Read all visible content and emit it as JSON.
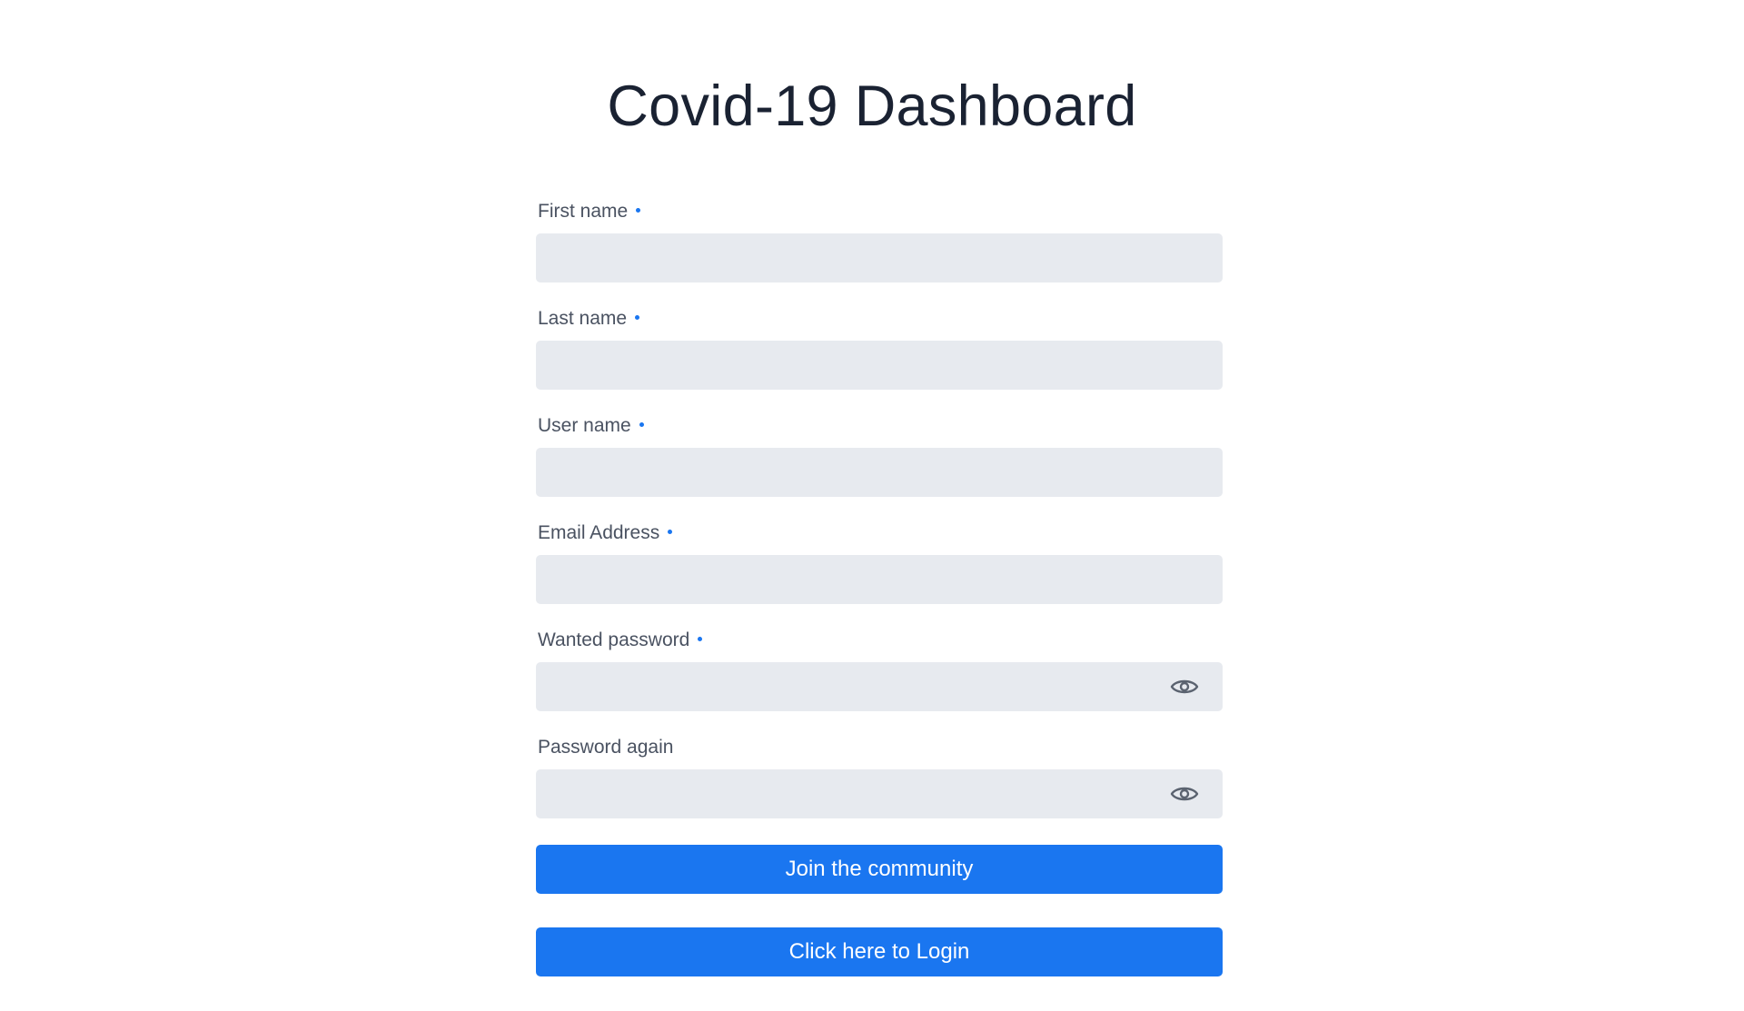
{
  "page": {
    "title": "Covid-19 Dashboard"
  },
  "colors": {
    "accent": "#1a76f0",
    "input_bg": "#e7eaef",
    "label_text": "#4a5261",
    "title_text": "#1a2232",
    "icon": "#5b6370"
  },
  "form": {
    "fields": [
      {
        "label": "First name",
        "required": true,
        "value": "",
        "type": "text"
      },
      {
        "label": "Last name",
        "required": true,
        "value": "",
        "type": "text"
      },
      {
        "label": "User name",
        "required": true,
        "value": "",
        "type": "text"
      },
      {
        "label": "Email Address",
        "required": true,
        "value": "",
        "type": "email"
      },
      {
        "label": "Wanted password",
        "required": true,
        "value": "",
        "type": "password",
        "toggle_icon": "eye-icon"
      },
      {
        "label": "Password again",
        "required": false,
        "value": "",
        "type": "password",
        "toggle_icon": "eye-icon"
      }
    ],
    "join_button_label": "Join the community",
    "login_button_label": "Click here to Login"
  }
}
